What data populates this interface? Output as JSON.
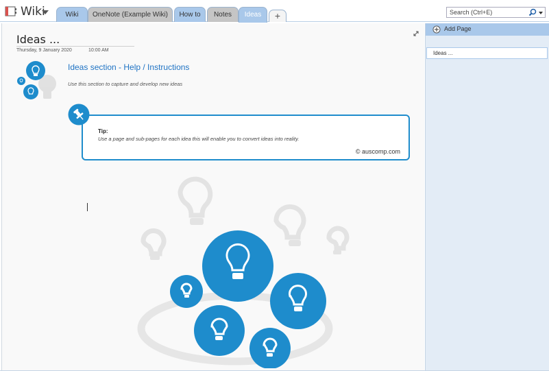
{
  "notebook": {
    "title": "Wiki",
    "icon": "notebook-icon"
  },
  "tabs": [
    {
      "label": "Wiki",
      "active": false
    },
    {
      "label": "OneNote (Example Wiki)",
      "active": false
    },
    {
      "label": "How to",
      "active": false
    },
    {
      "label": "Notes",
      "active": false
    },
    {
      "label": "Ideas",
      "active": true
    },
    {
      "label": "+",
      "active": false
    }
  ],
  "search": {
    "placeholder": "Search (Ctrl+E)"
  },
  "page": {
    "title": "Ideas ...",
    "date": "Thursday, 9 January 2020",
    "time": "10:00 AM",
    "help_title": "Ideas section - Help / Instructions",
    "help_subtitle": "Use this section to capture and develop new ideas",
    "tip_label": "Tip:",
    "tip_text": "Use a page and sub-pages for each idea this will enable you to convert ideas into reality.",
    "credit": "© auscomp.com"
  },
  "right_pane": {
    "add_page_label": "Add Page",
    "pages": [
      {
        "label": "Ideas ..."
      }
    ]
  },
  "colors": {
    "accent": "#1e8ccc",
    "tab_blue": "#a9c8ea",
    "tab_grey": "#c5c5c5",
    "pane_bg": "#e3ecf6",
    "link": "#1f73c4"
  }
}
